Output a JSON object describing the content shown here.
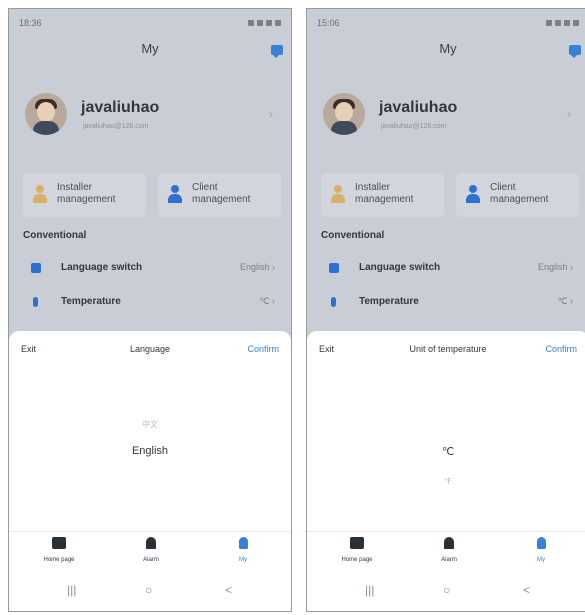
{
  "screens": [
    {
      "status_time": "18:36",
      "header_title": "My",
      "profile": {
        "username": "javaliuhao",
        "email": "javaliuhao@126.com"
      },
      "cards": [
        {
          "label": "Installer management",
          "icon": "installer-icon"
        },
        {
          "label": "Client management",
          "icon": "client-icon"
        }
      ],
      "section_title": "Conventional",
      "settings": [
        {
          "label": "Language switch",
          "value": "English",
          "icon": "language-icon"
        },
        {
          "label": "Temperature",
          "value": "℃",
          "icon": "thermometer-icon"
        }
      ],
      "sheet": {
        "exit_label": "Exit",
        "title": "Language",
        "confirm_label": "Confirm",
        "options": [
          "中文",
          "English"
        ],
        "selected": "English"
      },
      "nav": [
        {
          "label": "Home page",
          "icon": "chart-icon"
        },
        {
          "label": "Alarm",
          "icon": "alarm-icon"
        },
        {
          "label": "My",
          "icon": "person-icon"
        }
      ],
      "system_nav": [
        "|||",
        "○",
        "<"
      ]
    },
    {
      "status_time": "15:06",
      "header_title": "My",
      "profile": {
        "username": "javaliuhao",
        "email": "javaliuhao@126.com"
      },
      "cards": [
        {
          "label": "Installer management",
          "icon": "installer-icon"
        },
        {
          "label": "Client management",
          "icon": "client-icon"
        }
      ],
      "section_title": "Conventional",
      "settings": [
        {
          "label": "Language switch",
          "value": "English",
          "icon": "language-icon"
        },
        {
          "label": "Temperature",
          "value": "℃",
          "icon": "thermometer-icon"
        }
      ],
      "sheet": {
        "exit_label": "Exit",
        "title": "Unit of temperature",
        "confirm_label": "Confirm",
        "options": [
          "℃",
          "℉"
        ],
        "selected": "℃"
      },
      "nav": [
        {
          "label": "Home page",
          "icon": "chart-icon"
        },
        {
          "label": "Alarm",
          "icon": "alarm-icon"
        },
        {
          "label": "My",
          "icon": "person-icon"
        }
      ],
      "system_nav": [
        "|||",
        "○",
        "<"
      ]
    }
  ],
  "colors": {
    "accent": "#3b7fd6",
    "overlay": "#c9ced6",
    "installer": "#d8b06a",
    "client": "#2f6fd0",
    "thermometer": "#2f6fd0"
  }
}
